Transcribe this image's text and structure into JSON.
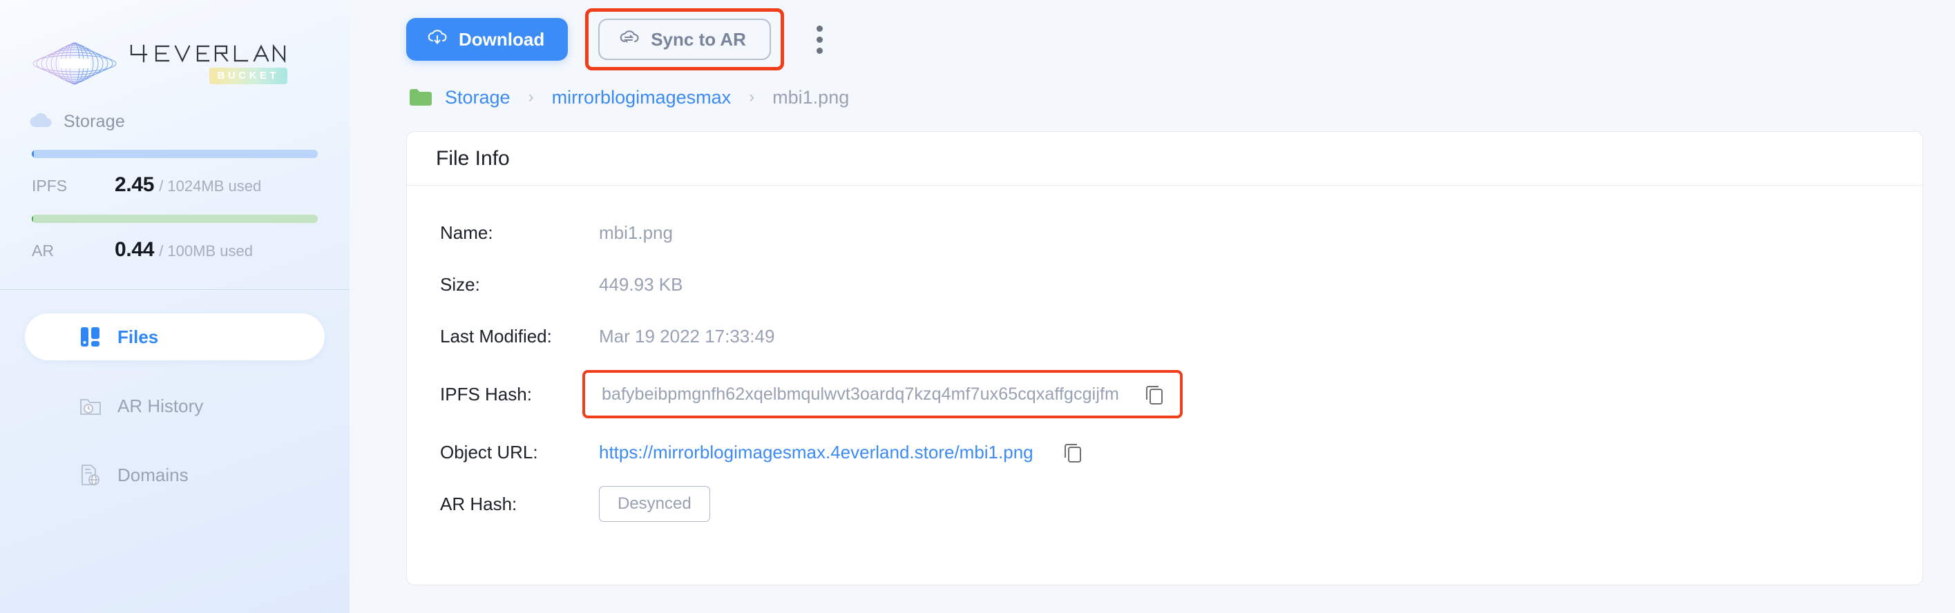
{
  "brand": {
    "name": "4EVERLAND",
    "badge": "BUCKET"
  },
  "sidebar": {
    "storage_label": "Storage",
    "quotas": [
      {
        "name": "IPFS",
        "used": "2.45",
        "total": "/ 1024MB used",
        "percent": 2.4,
        "color": "#3c8df5"
      },
      {
        "name": "AR",
        "used": "0.44",
        "total": "/ 100MB used",
        "percent": 1.0,
        "color": "#3faa48"
      }
    ],
    "items": [
      {
        "label": "Files",
        "icon": "files-icon",
        "active": true
      },
      {
        "label": "AR History",
        "icon": "ar-history-icon",
        "active": false
      },
      {
        "label": "Domains",
        "icon": "domains-icon",
        "active": false
      }
    ]
  },
  "toolbar": {
    "download_label": "Download",
    "sync_label": "Sync to AR",
    "more_label": "More options",
    "highlight_color": "#ef3e19"
  },
  "breadcrumb": {
    "items": [
      {
        "label": "Storage",
        "current": false
      },
      {
        "label": "mirrorblogimagesmax",
        "current": false
      },
      {
        "label": "mbi1.png",
        "current": true
      }
    ],
    "separator": "›"
  },
  "card": {
    "title": "File Info",
    "rows": [
      {
        "label": "Name:",
        "value": "mbi1.png",
        "type": "text"
      },
      {
        "label": "Size:",
        "value": "449.93 KB",
        "type": "text"
      },
      {
        "label": "Last Modified:",
        "value": "Mar 19 2022 17:33:49",
        "type": "text"
      },
      {
        "label": "IPFS Hash:",
        "value": "bafybeibpmgnfh62xqelbmqulwvt3oardq7kzq4mf7ux65cqxaffgcgijfm",
        "type": "hash",
        "highlighted": true
      },
      {
        "label": "Object URL:",
        "value": "https://mirrorblogimagesmax.4everland.store/mbi1.png",
        "type": "link"
      },
      {
        "label": "AR Hash:",
        "value": "Desynced",
        "type": "badge"
      }
    ]
  }
}
